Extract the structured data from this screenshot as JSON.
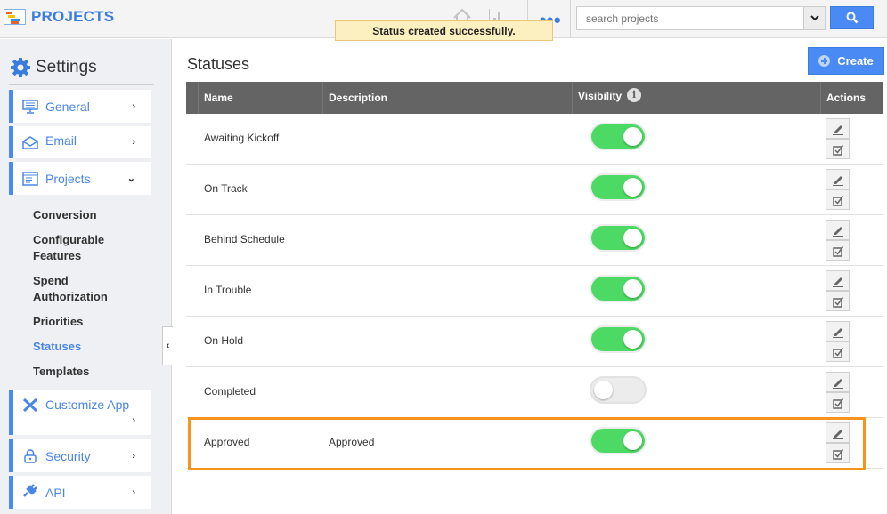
{
  "header": {
    "app_title": "PROJECTS",
    "search": {
      "placeholder": "search projects",
      "value": ""
    },
    "toast": "Status created successfully."
  },
  "sidebar": {
    "title": "Settings",
    "items": [
      {
        "label": "General",
        "icon": "monitor-icon",
        "chevron": "›"
      },
      {
        "label": "Email",
        "icon": "envelope-open-icon",
        "chevron": "›"
      },
      {
        "label": "Projects",
        "icon": "window-icon",
        "chevron": "⌄",
        "expanded": true
      },
      {
        "label": "Customize App",
        "icon": "tools-icon",
        "chevron": "›"
      },
      {
        "label": "Security",
        "icon": "lock-icon",
        "chevron": "›"
      },
      {
        "label": "API",
        "icon": "plug-icon",
        "chevron": "›"
      }
    ],
    "subitems": [
      {
        "label": "Conversion"
      },
      {
        "label": "Configurable Features"
      },
      {
        "label": "Spend Authorization"
      },
      {
        "label": "Priorities"
      },
      {
        "label": "Statuses",
        "active": true
      },
      {
        "label": "Templates"
      }
    ],
    "collapse_glyph": "‹"
  },
  "main": {
    "title": "Statuses",
    "create_label": "Create",
    "columns": [
      "Name",
      "Description",
      "Visibility",
      "Actions"
    ],
    "rows": [
      {
        "name": "Awaiting Kickoff",
        "description": "",
        "visible": true
      },
      {
        "name": "On Track",
        "description": "",
        "visible": true
      },
      {
        "name": "Behind Schedule",
        "description": "",
        "visible": true
      },
      {
        "name": "In Trouble",
        "description": "",
        "visible": true
      },
      {
        "name": "On Hold",
        "description": "",
        "visible": true
      },
      {
        "name": "Completed",
        "description": "",
        "visible": false
      },
      {
        "name": "Approved",
        "description": "Approved",
        "visible": true,
        "highlighted": true
      }
    ]
  },
  "colors": {
    "accent": "#4a8af4",
    "toggle_on": "#4cd964",
    "highlight": "#f7941d",
    "toast_bg": "#fcefc0",
    "table_header": "#646464"
  }
}
